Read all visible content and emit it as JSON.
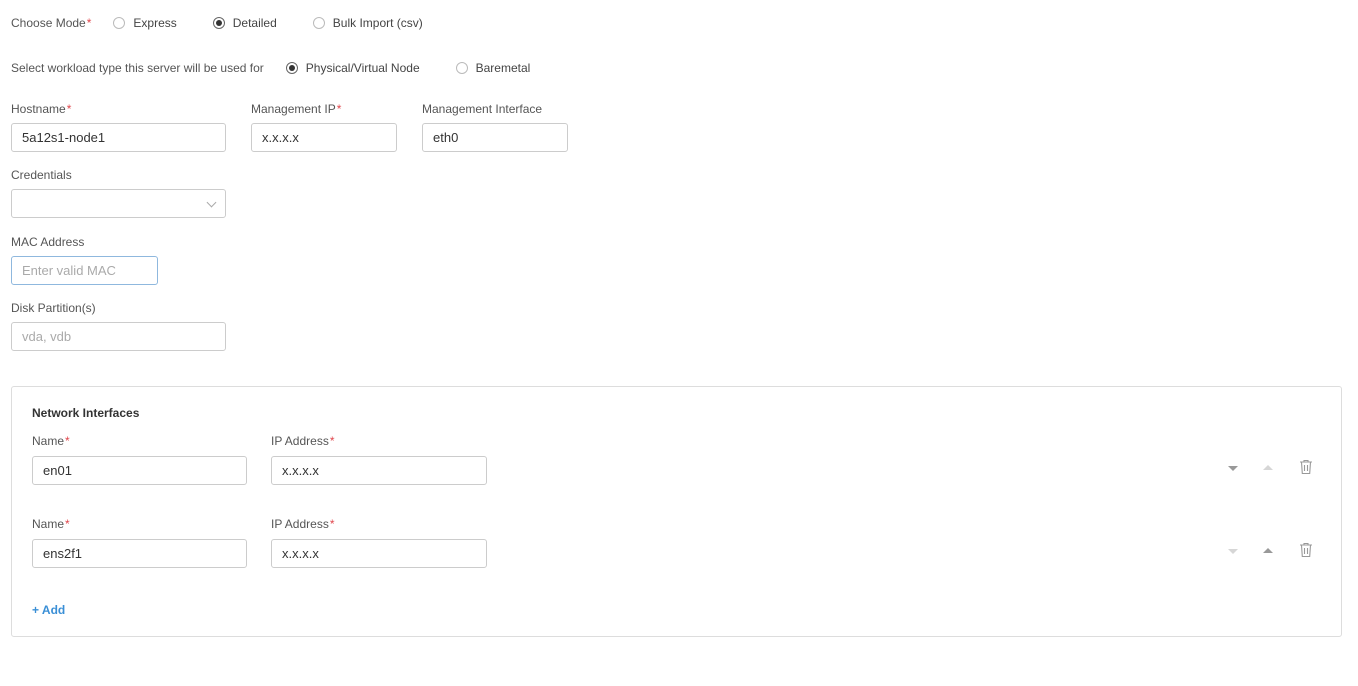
{
  "mode": {
    "label": "Choose Mode",
    "required_mark": "*",
    "options": [
      {
        "label": "Express",
        "selected": false
      },
      {
        "label": "Detailed",
        "selected": true
      },
      {
        "label": "Bulk Import (csv)",
        "selected": false
      }
    ]
  },
  "workload": {
    "label": "Select workload type this server will be used for",
    "options": [
      {
        "label": "Physical/Virtual Node",
        "selected": true
      },
      {
        "label": "Baremetal",
        "selected": false
      }
    ]
  },
  "hostname": {
    "label": "Hostname",
    "required_mark": "*",
    "value": "5a12s1-node1"
  },
  "management_ip": {
    "label": "Management IP",
    "required_mark": "*",
    "value": "x.x.x.x"
  },
  "management_interface": {
    "label": "Management Interface",
    "value": "eth0"
  },
  "credentials": {
    "label": "Credentials",
    "value": ""
  },
  "mac_address": {
    "label": "MAC Address",
    "value": "",
    "placeholder": "Enter valid MAC"
  },
  "disk_partitions": {
    "label": "Disk Partition(s)",
    "value": "",
    "placeholder": "vda, vdb"
  },
  "network_interfaces": {
    "title": "Network Interfaces",
    "rows": [
      {
        "name_label": "Name",
        "name_value": "en01",
        "ip_label": "IP Address",
        "ip_value": "x.x.x.x"
      },
      {
        "name_label": "Name",
        "name_value": "ens2f1",
        "ip_label": "IP Address",
        "ip_value": "x.x.x.x"
      }
    ],
    "required_mark": "*",
    "add_label": "+ Add"
  },
  "icons": {
    "move_down": "triangle-down-icon",
    "move_up": "triangle-up-icon",
    "delete": "trash-icon",
    "dropdown": "chevron-down-icon"
  },
  "colors": {
    "required": "#e0464c",
    "link": "#3a8fd6",
    "focus_border": "#8fb8de"
  }
}
